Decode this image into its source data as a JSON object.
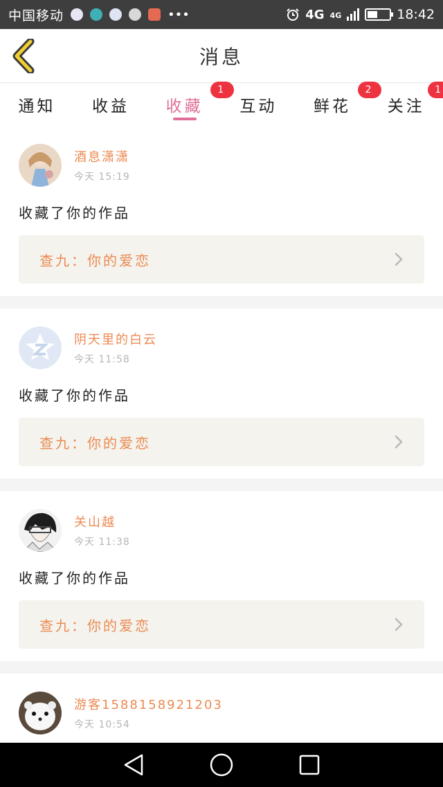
{
  "status_bar": {
    "carrier": "中国移动",
    "network": "4G",
    "network_small": "4G",
    "time": "18:42",
    "battery_level": 0.45,
    "icons": [
      "browser-icon",
      "moon-icon",
      "app-icon",
      "face-icon",
      "alert-app-icon",
      "more-icon",
      "alarm-icon",
      "signal-icon",
      "battery-icon"
    ]
  },
  "header": {
    "title": "消息",
    "back_icon": "chevron-left-icon"
  },
  "tabs": [
    {
      "label": "通知",
      "badge": "",
      "active": false
    },
    {
      "label": "收益",
      "badge": "",
      "active": false
    },
    {
      "label": "收藏",
      "badge": "1",
      "active": true
    },
    {
      "label": "互动",
      "badge": "",
      "active": false
    },
    {
      "label": "鲜花",
      "badge": "2",
      "active": false
    },
    {
      "label": "关注",
      "badge": "1",
      "active": false
    }
  ],
  "items": [
    {
      "user": "酒息潇潇",
      "time": "今天 15:19",
      "action": "收藏了你的作品",
      "work": "查九：你的爱恋",
      "avatar": "doll-avatar"
    },
    {
      "user": "阴天里的白云",
      "time": "今天 11:58",
      "action": "收藏了你的作品",
      "work": "查九：你的爱恋",
      "avatar": "default-star-avatar"
    },
    {
      "user": "关山越",
      "time": "今天 11:38",
      "action": "收藏了你的作品",
      "work": "查九：你的爱恋",
      "avatar": "anime-avatar"
    },
    {
      "user": "游客1588158921203",
      "time": "今天 10:54",
      "action": "",
      "work": "",
      "avatar": "weasel-avatar"
    }
  ],
  "colors": {
    "accent": "#e0709a",
    "username": "#ec8a52",
    "badge": "#ee3340",
    "link_bg": "#f4f3ee"
  },
  "nav": [
    "back-triangle-icon",
    "home-circle-icon",
    "recents-square-icon"
  ]
}
